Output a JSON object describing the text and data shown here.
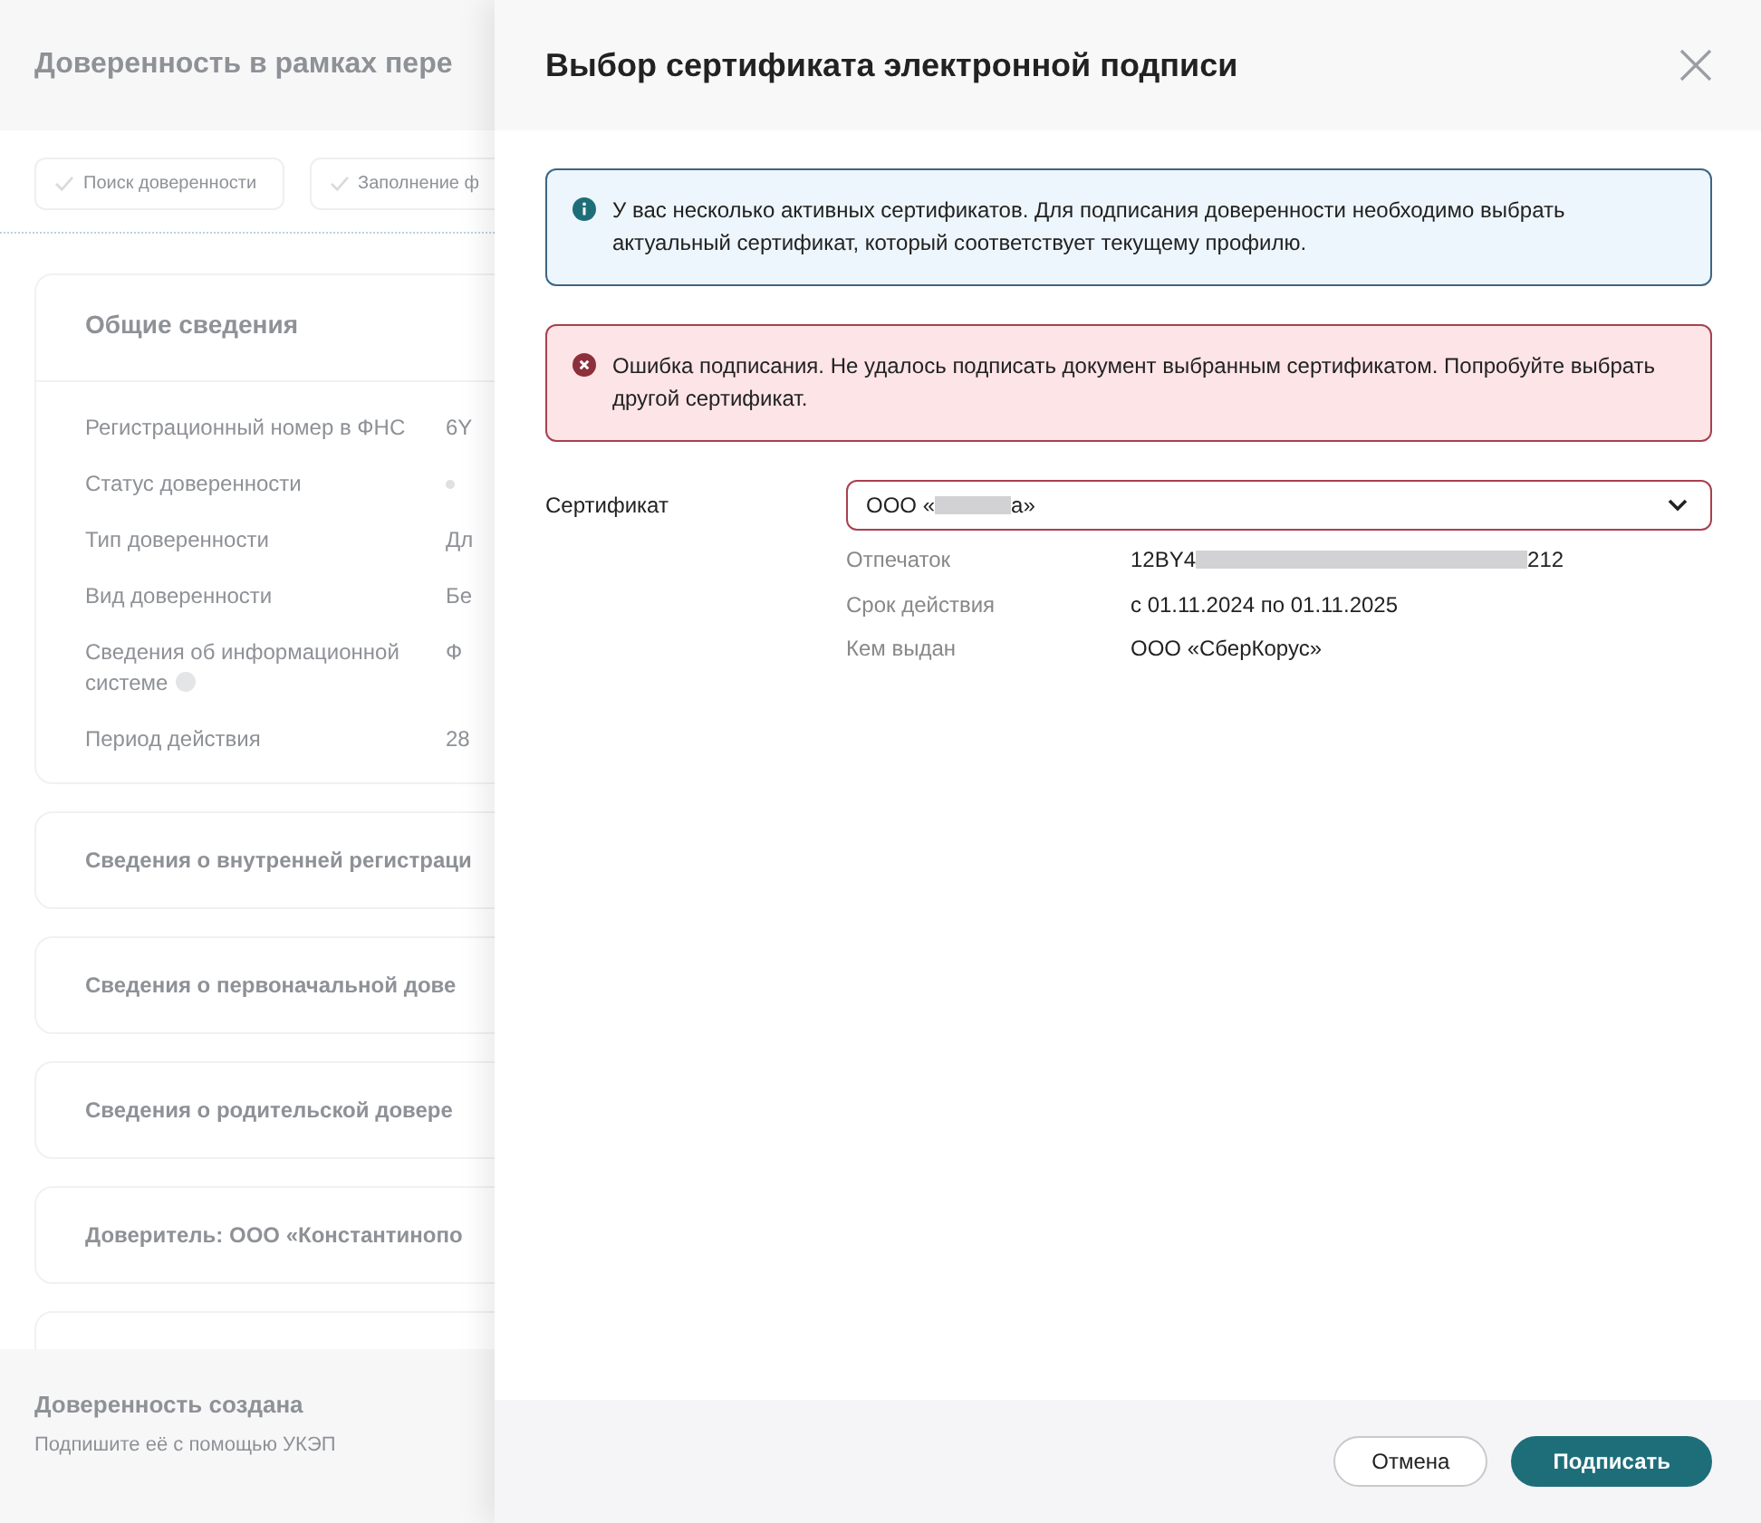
{
  "page": {
    "title": "Доверенность в рамках пере",
    "steps": [
      {
        "label": "Поиск доверенности",
        "done": true
      },
      {
        "label": "Заполнение ф",
        "done": true
      }
    ],
    "general": {
      "title": "Общие сведения",
      "rows": [
        {
          "label": "Регистрационный номер в ФНС",
          "value": "6Y",
          "kind": "text"
        },
        {
          "label": "Статус доверенности",
          "kind": "status"
        },
        {
          "label": "Тип доверенности",
          "value": "Дл",
          "kind": "text"
        },
        {
          "label": "Вид доверенности",
          "value": "Бе",
          "kind": "text"
        },
        {
          "label": "Сведения об информационной системе",
          "value": "Ф",
          "kind": "help"
        },
        {
          "label": "Период действия",
          "value": "28",
          "kind": "text"
        }
      ]
    },
    "sections": [
      "Сведения о внутренней регистраци",
      "Сведения о первоначальной дове",
      "Сведения о родительской довере",
      "Доверитель: ООО «Константинопо"
    ],
    "footer": {
      "title": "Доверенность создана",
      "subtitle": "Подпишите её с помощью УКЭП"
    }
  },
  "dialog": {
    "title": "Выбор сертификата электронной подписи",
    "alerts": [
      {
        "kind": "info",
        "text": "У вас несколько активных сертификатов. Для подписания доверенности необходимо выбрать актуальный сертификат, который соответствует текущему профилю."
      },
      {
        "kind": "error",
        "text": "Ошибка подписания. Не удалось подписать документ выбранным сертификатом. Попробуйте выбрать другой сертификат."
      }
    ],
    "certificate": {
      "label": "Сертификат",
      "value_start": "ООО «",
      "value_end": "а»",
      "invalid": true
    },
    "details": [
      {
        "label": "Отпечаток",
        "value_start": "12BY4",
        "value_end": "212",
        "redacted": true
      },
      {
        "label": "Срок действия",
        "value_start": "с 01.11.2024 по 01.11.2025",
        "redacted": false
      },
      {
        "label": "Кем выдан",
        "value_start": "ООО «СберКорус»",
        "redacted": false
      }
    ],
    "buttons": [
      {
        "label": "Отмена",
        "kind": "secondary"
      },
      {
        "label": "Подписать",
        "kind": "primary"
      }
    ]
  }
}
